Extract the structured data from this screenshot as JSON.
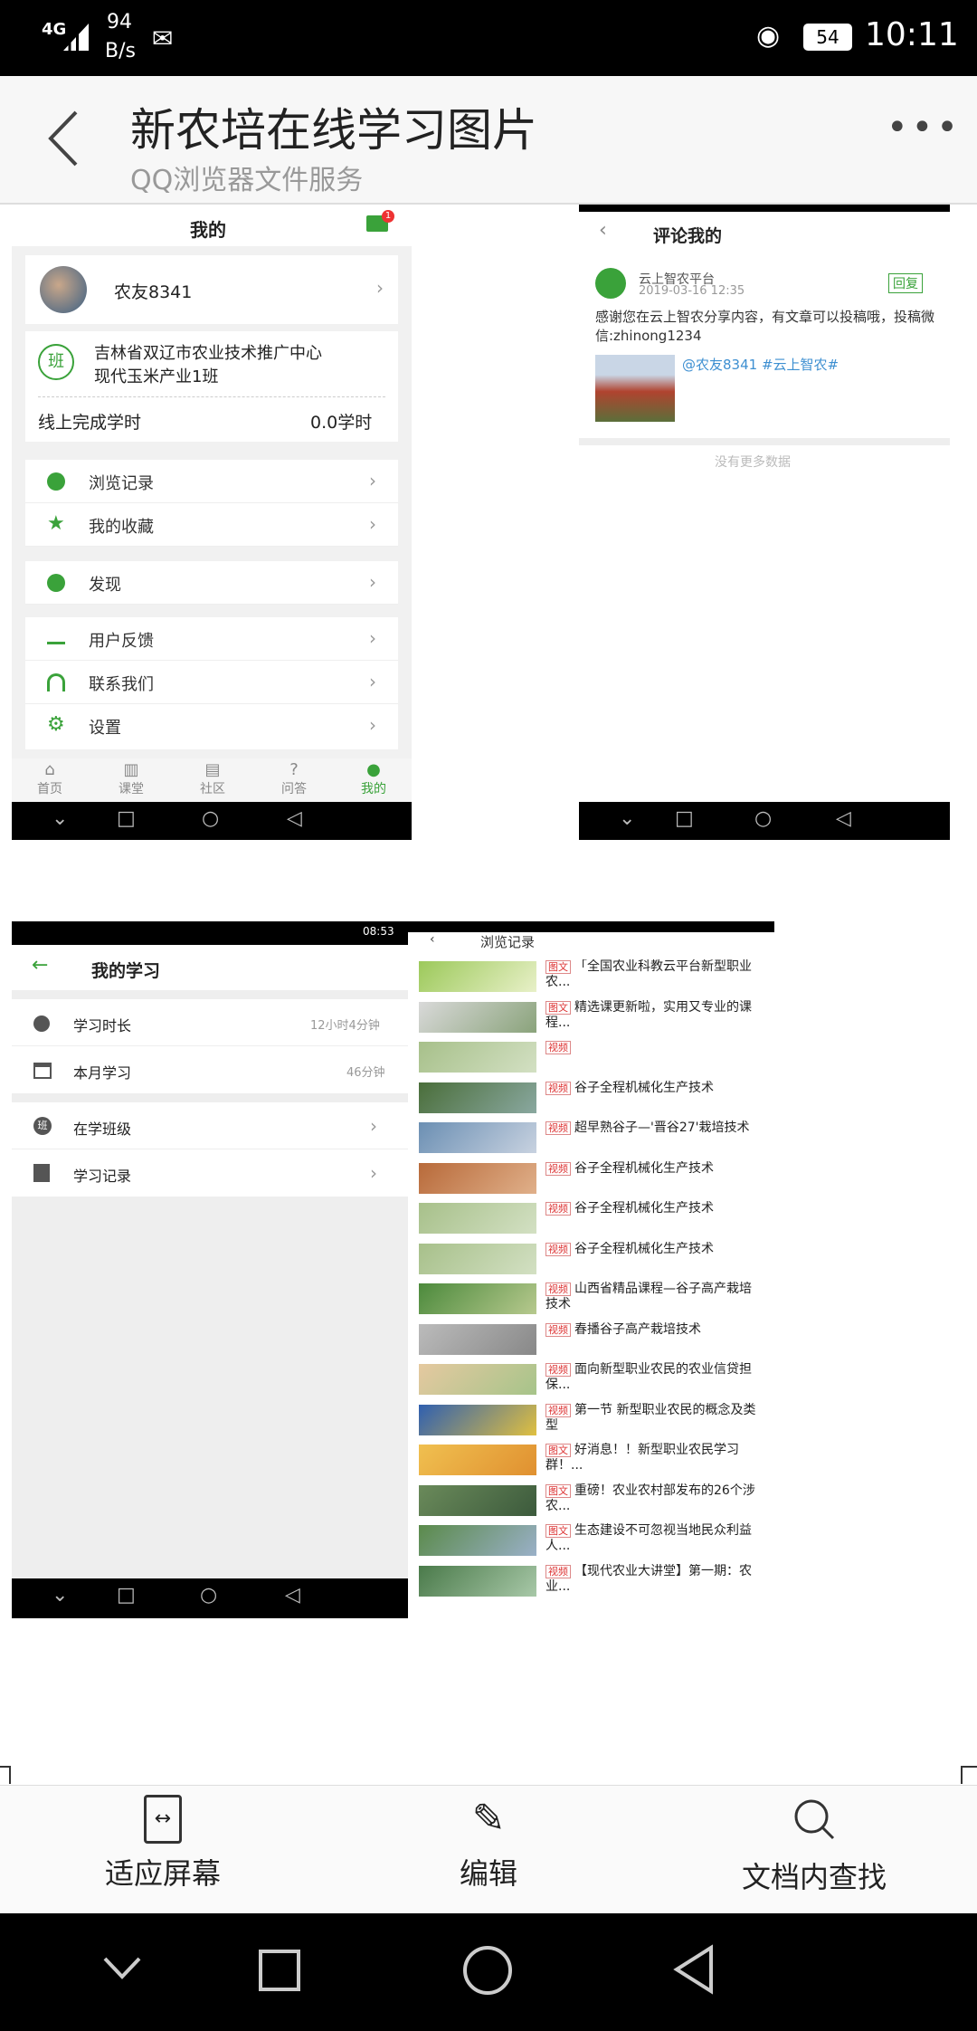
{
  "status_bar": {
    "network": "4G",
    "speed_value": "94",
    "speed_unit": "B/s",
    "battery": "54",
    "time": "10:11"
  },
  "header": {
    "title": "新农培在线学习图片",
    "subtitle": "QQ浏览器文件服务"
  },
  "panel_mine": {
    "title": "我的",
    "badge": "1",
    "username": "农友8341",
    "class_badge": "班",
    "org_line1": "吉林省双辽市农业技术推广中心",
    "org_line2": "现代玉米产业1班",
    "hours_label": "线上完成学时",
    "hours_value": "0.0学时",
    "menu": [
      "浏览记录",
      "我的收藏",
      "发现",
      "用户反馈",
      "联系我们",
      "设置"
    ],
    "tabs": [
      "首页",
      "课堂",
      "社区",
      "问答",
      "我的"
    ]
  },
  "panel_comments": {
    "title": "评论我的",
    "author": "云上智农平台",
    "date": "2019-03-16 12:35",
    "reply_label": "回复",
    "text": "感谢您在云上智农分享内容，有文章可以投稿哦，投稿微信:zhinong1234",
    "mention": "@农友8341 #云上智农#",
    "no_more": "没有更多数据"
  },
  "panel_study": {
    "time": "08:53",
    "title": "我的学习",
    "rows": [
      {
        "label": "学习时长",
        "value": "12小时4分钟"
      },
      {
        "label": "本月学习",
        "value": "46分钟"
      }
    ],
    "links": [
      "在学班级",
      "学习记录"
    ]
  },
  "panel_history": {
    "title": "浏览记录",
    "items": [
      {
        "tag": "图文",
        "text": "「全国农业科教云平台新型职业农..."
      },
      {
        "tag": "图文",
        "text": "精选课更新啦，实用又专业的课程..."
      },
      {
        "tag": "视频",
        "text": ""
      },
      {
        "tag": "视频",
        "text": "谷子全程机械化生产技术"
      },
      {
        "tag": "视频",
        "text": "超早熟谷子—'晋谷27'栽培技术"
      },
      {
        "tag": "视频",
        "text": "谷子全程机械化生产技术"
      },
      {
        "tag": "视频",
        "text": "谷子全程机械化生产技术"
      },
      {
        "tag": "视频",
        "text": "谷子全程机械化生产技术"
      },
      {
        "tag": "视频",
        "text": "山西省精品课程—谷子高产栽培技术"
      },
      {
        "tag": "视频",
        "text": "春播谷子高产栽培技术"
      },
      {
        "tag": "视频",
        "text": "面向新型职业农民的农业信贷担保..."
      },
      {
        "tag": "视频",
        "text": "第一节 新型职业农民的概念及类型"
      },
      {
        "tag": "图文",
        "text": "好消息！！新型职业农民学习群！..."
      },
      {
        "tag": "图文",
        "text": "重磅！农业农村部发布的26个涉农..."
      },
      {
        "tag": "图文",
        "text": "生态建设不可忽视当地民众利益 人..."
      },
      {
        "tag": "视频",
        "text": "【现代农业大讲堂】第一期：农业..."
      }
    ]
  },
  "bottom_actions": [
    "适应屏幕",
    "编辑",
    "文档内查找"
  ]
}
